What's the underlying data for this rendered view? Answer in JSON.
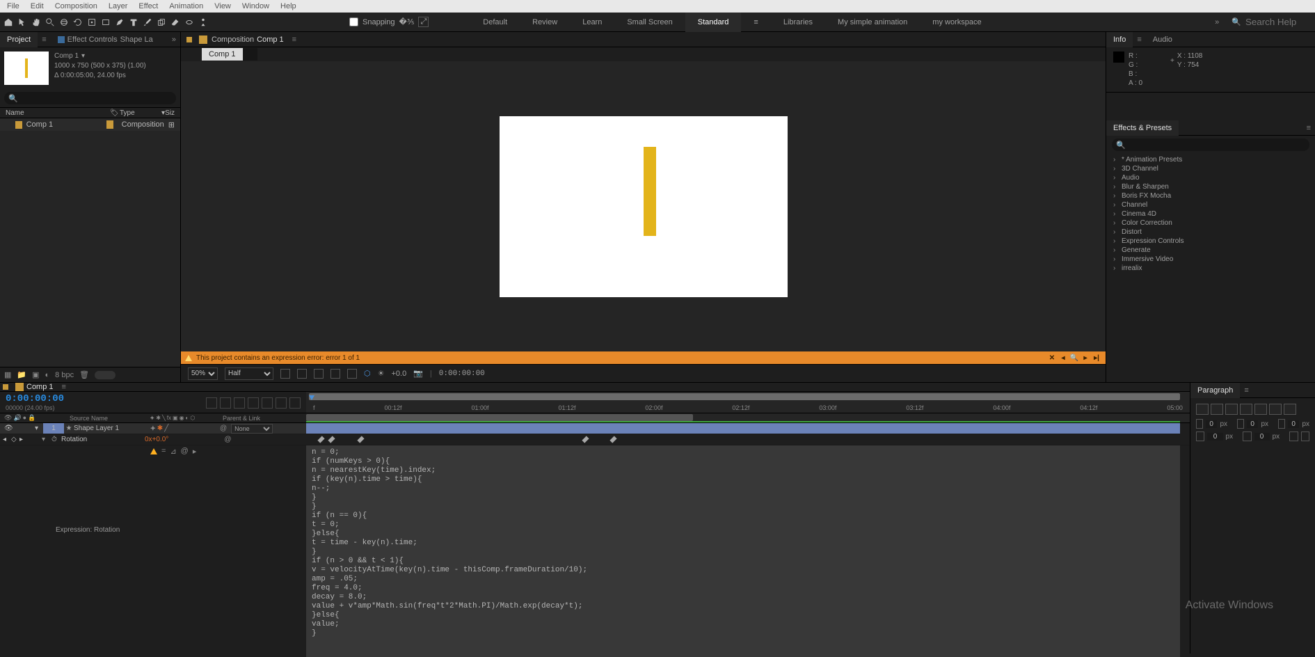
{
  "menubar": [
    "File",
    "Edit",
    "Composition",
    "Layer",
    "Effect",
    "Animation",
    "View",
    "Window",
    "Help"
  ],
  "snapping_label": "Snapping",
  "workspaces": [
    "Default",
    "Review",
    "Learn",
    "Small Screen",
    "Standard",
    "Libraries",
    "My simple animation",
    "my workspace"
  ],
  "workspace_active": "Standard",
  "search_help_placeholder": "Search Help",
  "left": {
    "tabs": {
      "project": "Project",
      "effect_controls": "Effect Controls",
      "shape": "Shape La"
    },
    "meta": {
      "name": "Comp 1",
      "dims": "1000 x 750  (500 x 375) (1.00)",
      "dur": "Δ 0:00:05:00, 24.00 fps"
    },
    "cols": {
      "name": "Name",
      "type": "Type",
      "size": "Siz"
    },
    "rows": [
      {
        "name": "Comp 1",
        "type": "Composition"
      }
    ],
    "bpc": "8 bpc"
  },
  "center": {
    "tab": "Composition",
    "comp": "Comp 1",
    "subtab": "Comp 1",
    "error": "This project contains an expression error: error 1 of 1",
    "zoom": "50%",
    "res": "Half",
    "exp": "+0.0",
    "tc": "0:00:00:00"
  },
  "right": {
    "info_tab": "Info",
    "audio_tab": "Audio",
    "info": {
      "r": "R :",
      "g": "G :",
      "b": "B :",
      "a": "A : 0",
      "x": "X : 1108",
      "y": "Y : 754"
    },
    "eff_title": "Effects & Presets",
    "eff_items": [
      "* Animation Presets",
      "3D Channel",
      "Audio",
      "Blur & Sharpen",
      "Boris FX Mocha",
      "Channel",
      "Cinema 4D",
      "Color Correction",
      "Distort",
      "Expression Controls",
      "Generate",
      "Immersive Video",
      "irrealix"
    ]
  },
  "timeline": {
    "tab": "Comp 1",
    "tc": "0:00:00:00",
    "tc_sub": "00000 (24.00 fps)",
    "ticks": [
      "f",
      "00:12f",
      "01:00f",
      "01:12f",
      "02:00f",
      "02:12f",
      "03:00f",
      "03:12f",
      "04:00f",
      "04:12f",
      "05:00"
    ],
    "col_head": {
      "source": "Source Name",
      "parent": "Parent & Link"
    },
    "layer": {
      "idx": "1",
      "name": "Shape Layer 1",
      "parent": "None"
    },
    "prop": {
      "name": "Rotation",
      "value": "0x+0.0°"
    },
    "expr_label": "Expression: Rotation",
    "kf_positions": [
      17,
      32,
      74,
      397,
      437
    ],
    "expression": "n = 0;\nif (numKeys > 0){\nn = nearestKey(time).index;\nif (key(n).time > time){\nn--;\n}\n}\nif (n == 0){\nt = 0;\n}else{\nt = time - key(n).time;\n}\nif (n > 0 && t < 1){\nv = velocityAtTime(key(n).time - thisComp.frameDuration/10);\namp = .05;\nfreq = 4.0;\ndecay = 8.0;\nvalue + v*amp*Math.sin(freq*t*2*Math.PI)/Math.exp(decay*t);\n}else{\nvalue;\n}"
  },
  "paragraph": {
    "title": "Paragraph",
    "val": "0",
    "unit": "px"
  },
  "watermark": "Activate Windows"
}
